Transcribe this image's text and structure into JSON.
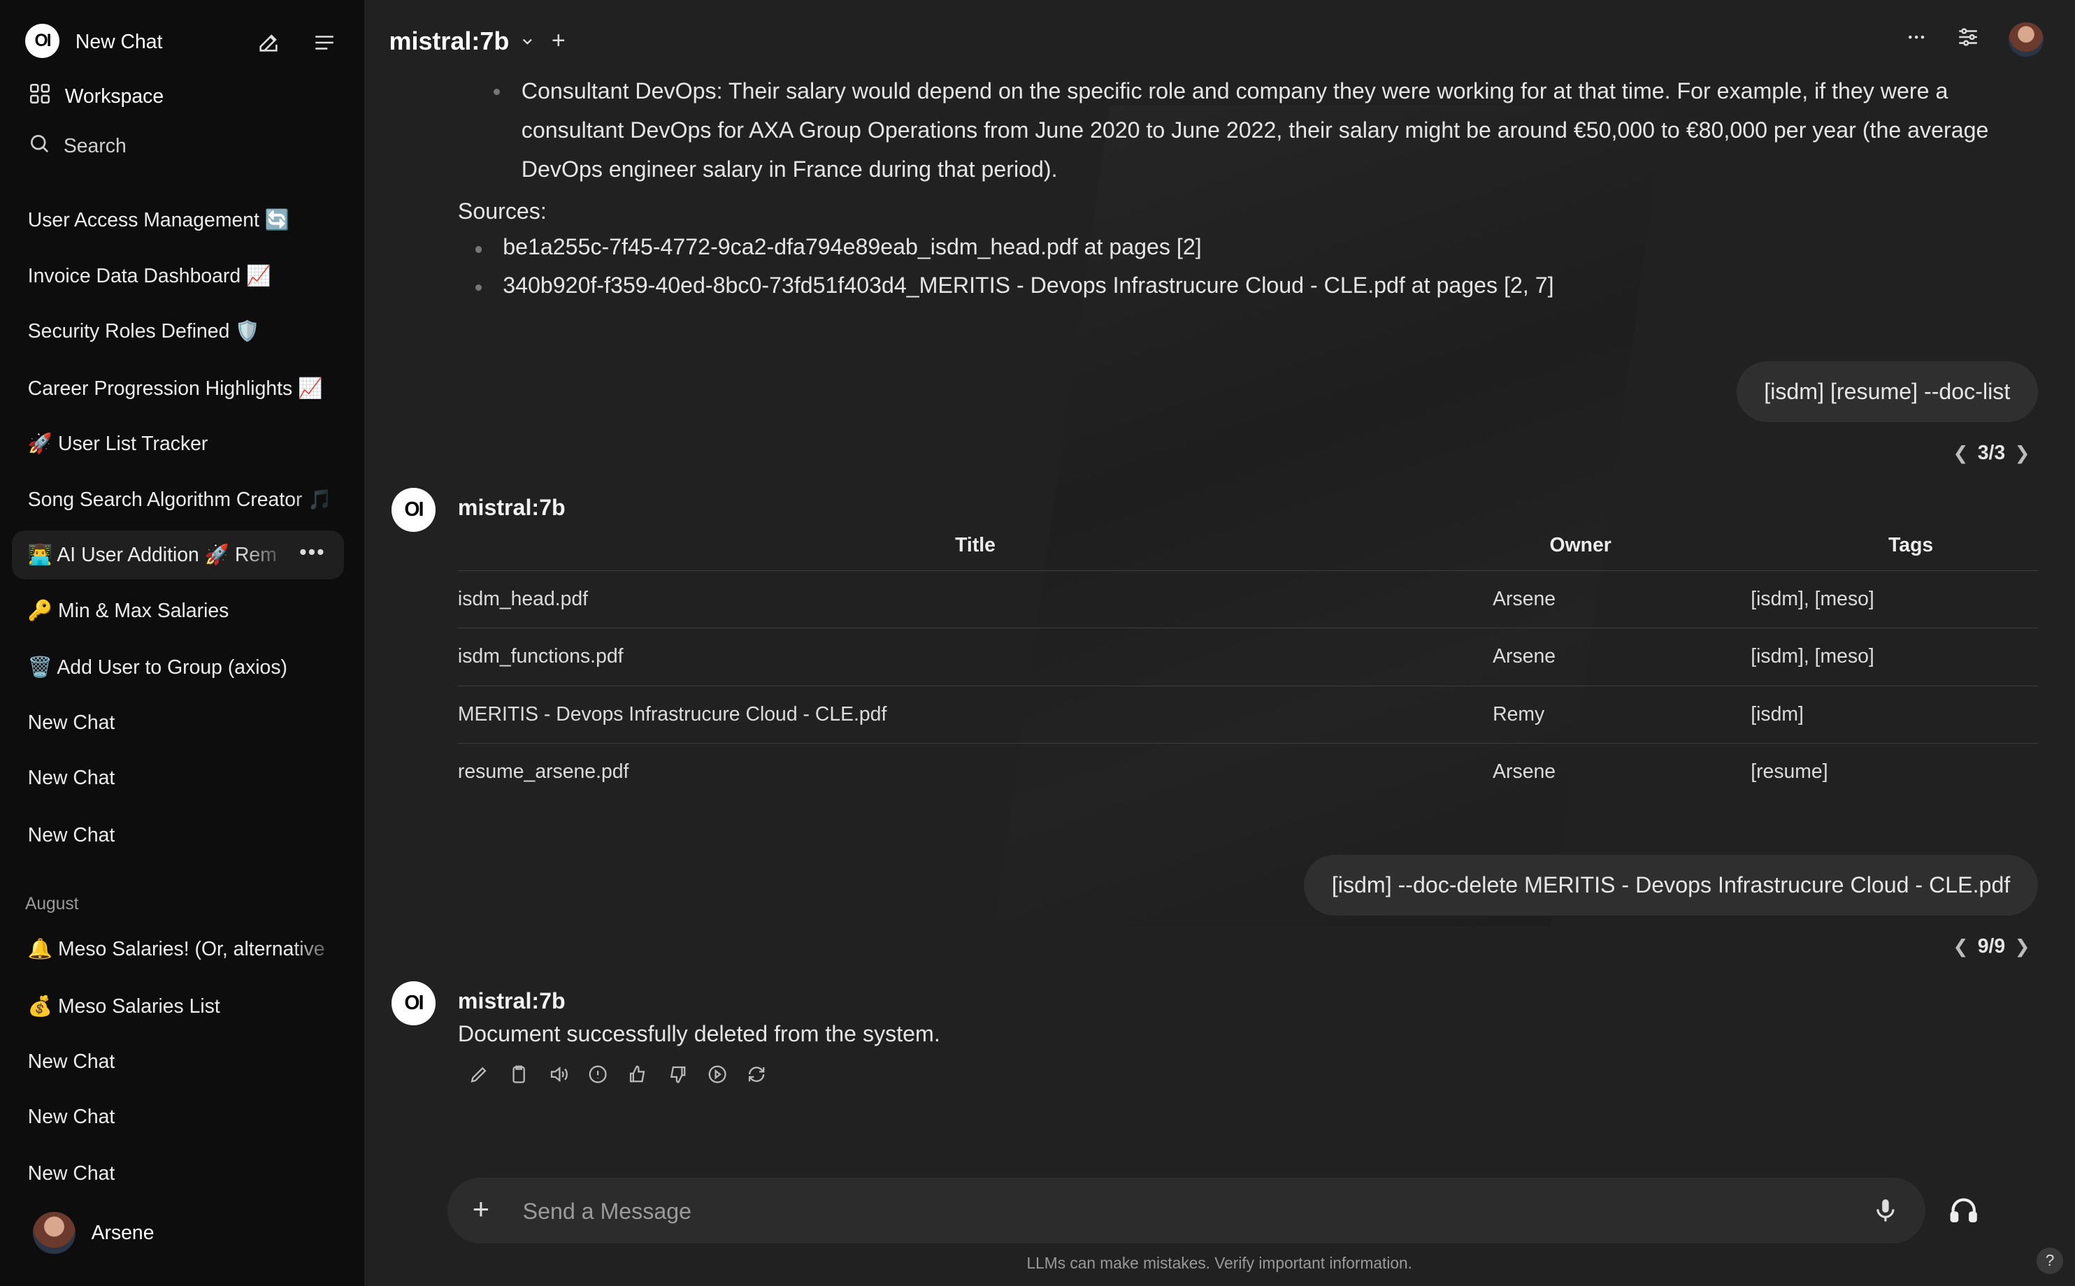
{
  "sidebar": {
    "logo_text": "OI",
    "new_chat_label": "New Chat",
    "workspace_label": "Workspace",
    "search_label": "Search",
    "items": [
      {
        "label": "User Access Management 🔄"
      },
      {
        "label": "Invoice Data Dashboard 📈"
      },
      {
        "label": "Security Roles Defined 🛡️"
      },
      {
        "label": "Career Progression Highlights 📈"
      },
      {
        "label": "🚀 User List Tracker"
      },
      {
        "label": "Song Search Algorithm Creator 🎵"
      },
      {
        "label": "👨‍💻 AI User Addition 🚀 Rem"
      },
      {
        "label": "🔑 Min & Max Salaries"
      },
      {
        "label": "🗑️ Add User to Group (axios)"
      },
      {
        "label": "New Chat"
      },
      {
        "label": "New Chat"
      },
      {
        "label": "New Chat"
      }
    ],
    "group_label": "August",
    "group_items": [
      {
        "label": "🔔 Meso Salaries! (Or, alternative"
      },
      {
        "label": "💰 Meso Salaries List"
      },
      {
        "label": "New Chat"
      },
      {
        "label": "New Chat"
      },
      {
        "label": "New Chat"
      }
    ],
    "user_name": "Arsene"
  },
  "header": {
    "model_name": "mistral:7b",
    "add_model": "+"
  },
  "conversation": {
    "prev_bullet": "Consultant DevOps: Their salary would depend on the specific role and company they were working for at that time. For example, if they were a consultant DevOps for AXA Group Operations from June 2020 to June 2022, their salary might be around €50,000 to €80,000 per year (the average DevOps engineer salary in France during that period).",
    "sources_label": "Sources:",
    "sources": [
      "be1a255c-7f45-4772-9ca2-dfa794e89eab_isdm_head.pdf at pages [2]",
      "340b920f-f359-40ed-8bc0-73fd51f403d4_MERITIS - Devops Infrastrucure Cloud - CLE.pdf at pages [2, 7]"
    ],
    "user_msg_1": "[isdm] [resume] --doc-list",
    "pager_1": "3/3",
    "bot_name": "mistral:7b",
    "bot_logo": "OI",
    "table": {
      "headers": [
        "Title",
        "Owner",
        "Tags"
      ],
      "rows": [
        [
          "isdm_head.pdf",
          "Arsene",
          "[isdm], [meso]"
        ],
        [
          "isdm_functions.pdf",
          "Arsene",
          "[isdm], [meso]"
        ],
        [
          "MERITIS - Devops Infrastrucure Cloud - CLE.pdf",
          "Remy",
          "[isdm]"
        ],
        [
          "resume_arsene.pdf",
          "Arsene",
          "[resume]"
        ]
      ]
    },
    "user_msg_2": "[isdm] --doc-delete MERITIS - Devops Infrastrucure Cloud - CLE.pdf",
    "pager_2": "9/9",
    "bot_reply": "Document successfully deleted from the system.",
    "actions": [
      "edit-icon",
      "copy-icon",
      "read-aloud-icon",
      "info-icon",
      "thumbs-up-icon",
      "thumbs-down-icon",
      "continue-icon",
      "regenerate-icon"
    ]
  },
  "composer": {
    "placeholder": "Send a Message",
    "value": ""
  },
  "footer": {
    "disclaimer": "LLMs can make mistakes. Verify important information.",
    "help": "?"
  },
  "colors": {
    "sidebar_bg": "#0d0d0d",
    "main_bg": "#212121",
    "bubble_bg": "#2f2f2f",
    "composer_bg": "#2c2c2c"
  }
}
